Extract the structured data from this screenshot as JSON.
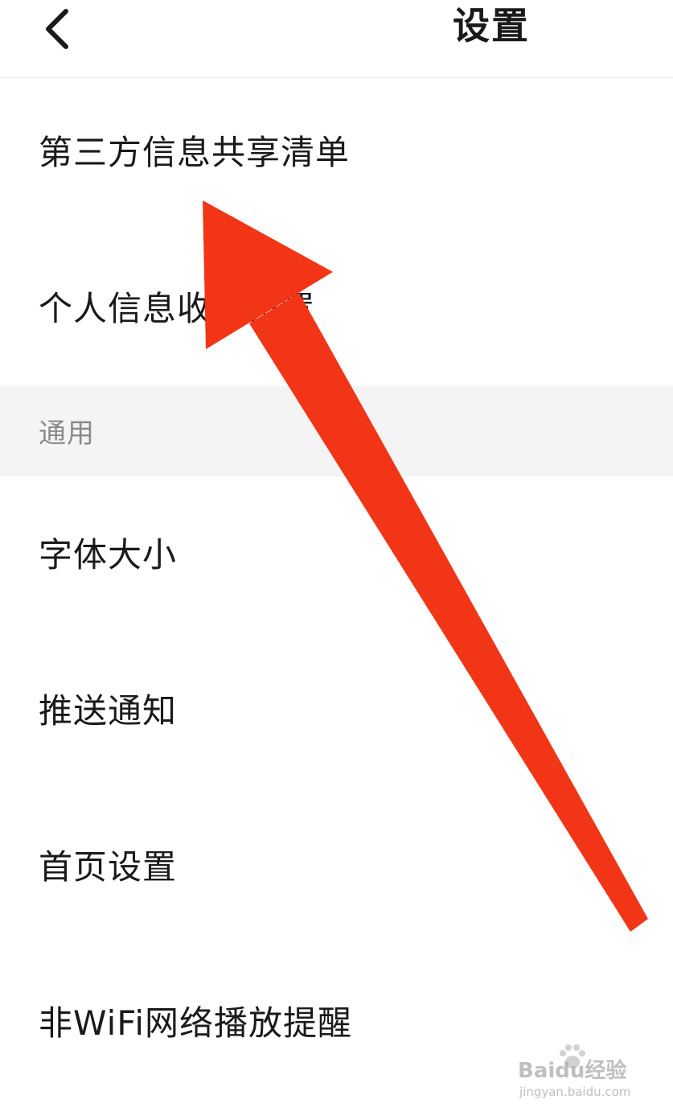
{
  "header": {
    "back_icon": "chevron-left-icon",
    "title": "设置"
  },
  "rows_top": [
    {
      "label": "第三方信息共享清单"
    },
    {
      "label": "个人信息收集设置"
    }
  ],
  "section": {
    "label": "通用"
  },
  "rows_general": [
    {
      "label": "字体大小"
    },
    {
      "label": "推送通知"
    },
    {
      "label": "首页设置"
    },
    {
      "label": "非WiFi网络播放提醒"
    }
  ],
  "annotation": {
    "icon": "red-arrow-annotation",
    "color": "#f23516"
  },
  "watermark": {
    "brand": "Baidu经验",
    "url": "jingyan.baidu.com"
  }
}
